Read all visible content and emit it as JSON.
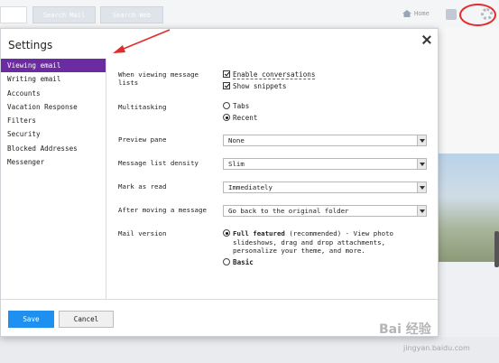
{
  "background": {
    "search_mail_label": "Search Mail",
    "search_web_label": "Search Web",
    "home_label": "Home"
  },
  "dialog": {
    "title": "Settings",
    "nav": [
      {
        "label": "Viewing email",
        "active": true
      },
      {
        "label": "Writing email"
      },
      {
        "label": "Accounts"
      },
      {
        "label": "Vacation Response"
      },
      {
        "label": "Filters"
      },
      {
        "label": "Security"
      },
      {
        "label": "Blocked Addresses"
      },
      {
        "label": "Messenger"
      }
    ],
    "settings": {
      "message_lists_label": "When viewing message lists",
      "enable_conversations": "Enable conversations",
      "show_snippets": "Show snippets",
      "multitasking_label": "Multitasking",
      "tabs_option": "Tabs",
      "recent_option": "Recent",
      "preview_pane_label": "Preview pane",
      "preview_pane_value": "None",
      "density_label": "Message list density",
      "density_value": "Slim",
      "mark_read_label": "Mark as read",
      "mark_read_value": "Immediately",
      "after_moving_label": "After moving a message",
      "after_moving_value": "Go back to the original folder",
      "mail_version_label": "Mail version",
      "full_featured": "Full featured",
      "full_featured_note": "(recommended) - View photo",
      "full_featured_desc": "slideshows, drag and drop attachments, personalize your theme, and more.",
      "basic": "Basic"
    },
    "save_label": "Save",
    "cancel_label": "Cancel"
  },
  "annotation_color": "#e32b2b",
  "accent_color": "#6a2ca0",
  "save_color": "#1e90f0",
  "watermark": {
    "main": "Bai 经验",
    "sub": "jingyan.baidu.com"
  }
}
